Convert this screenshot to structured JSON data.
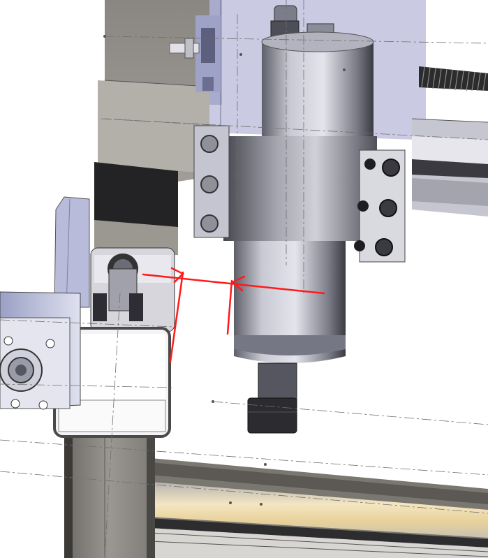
{
  "annotation": {
    "label": "?",
    "color": "#ff1a1a"
  },
  "colors": {
    "background": "#ffffff",
    "frame_gray": "#8f8a84",
    "frame_dark": "#2b2b2b",
    "plate_lavender": "#c9cbe2",
    "spindle_light": "#b9bac6",
    "spindle_dark": "#3f3f46",
    "bearing_silver": "#d3d3da",
    "rail_wood": "#f3e3b8"
  },
  "view": {
    "type": "cad-assembly-view",
    "parts": [
      "spindle-motor",
      "spindle-clamp",
      "z-axis-plate",
      "lead-screw",
      "linear-rail",
      "linear-bearing",
      "square-tube",
      "stepper-motor",
      "gantry-beam"
    ]
  }
}
